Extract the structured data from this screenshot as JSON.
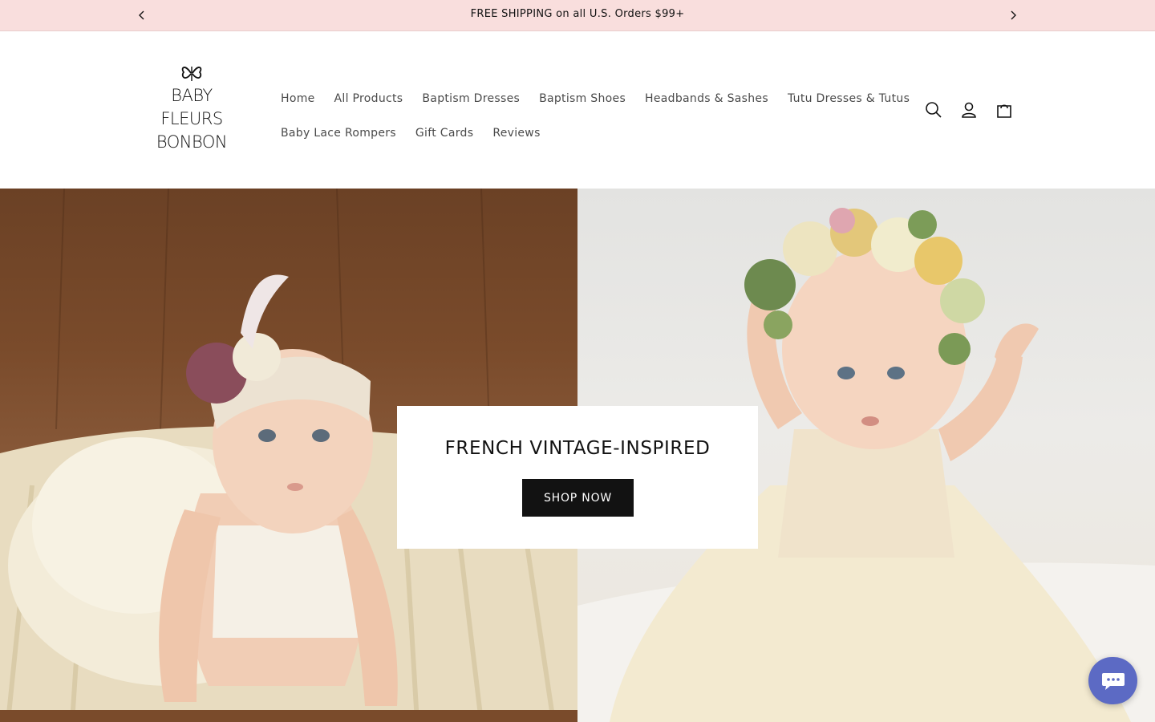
{
  "announcement": {
    "text": "FREE SHIPPING on all U.S. Orders $99+",
    "prev_icon": "chevron-left-icon",
    "next_icon": "chevron-right-icon",
    "background": "#f9dedd"
  },
  "logo": {
    "icon": "butterfly-icon",
    "lines": [
      "BABY",
      "FLEURS",
      "BONBON"
    ]
  },
  "nav": {
    "row1": [
      "Home",
      "All Products",
      "Baptism Dresses",
      "Baptism Shoes",
      "Headbands & Sashes",
      "Tutu Dresses & Tutus"
    ],
    "row2": [
      "Baby Lace Rompers",
      "Gift Cards",
      "Reviews"
    ]
  },
  "header_icons": {
    "search": "search-icon",
    "account": "user-icon",
    "cart": "shopping-bag-icon"
  },
  "hero": {
    "heading": "FRENCH VINTAGE-INSPIRED",
    "cta_label": "SHOP NOW",
    "left_image": "baby with lace headband and tutu on knit blanket",
    "right_image": "baby in cream tulle dress with flower crown"
  },
  "chat": {
    "icon": "chat-bubble-icon",
    "color": "#5c6ac4"
  },
  "colors": {
    "cta_background": "#121212",
    "nav_text": "#4a4a4a"
  }
}
